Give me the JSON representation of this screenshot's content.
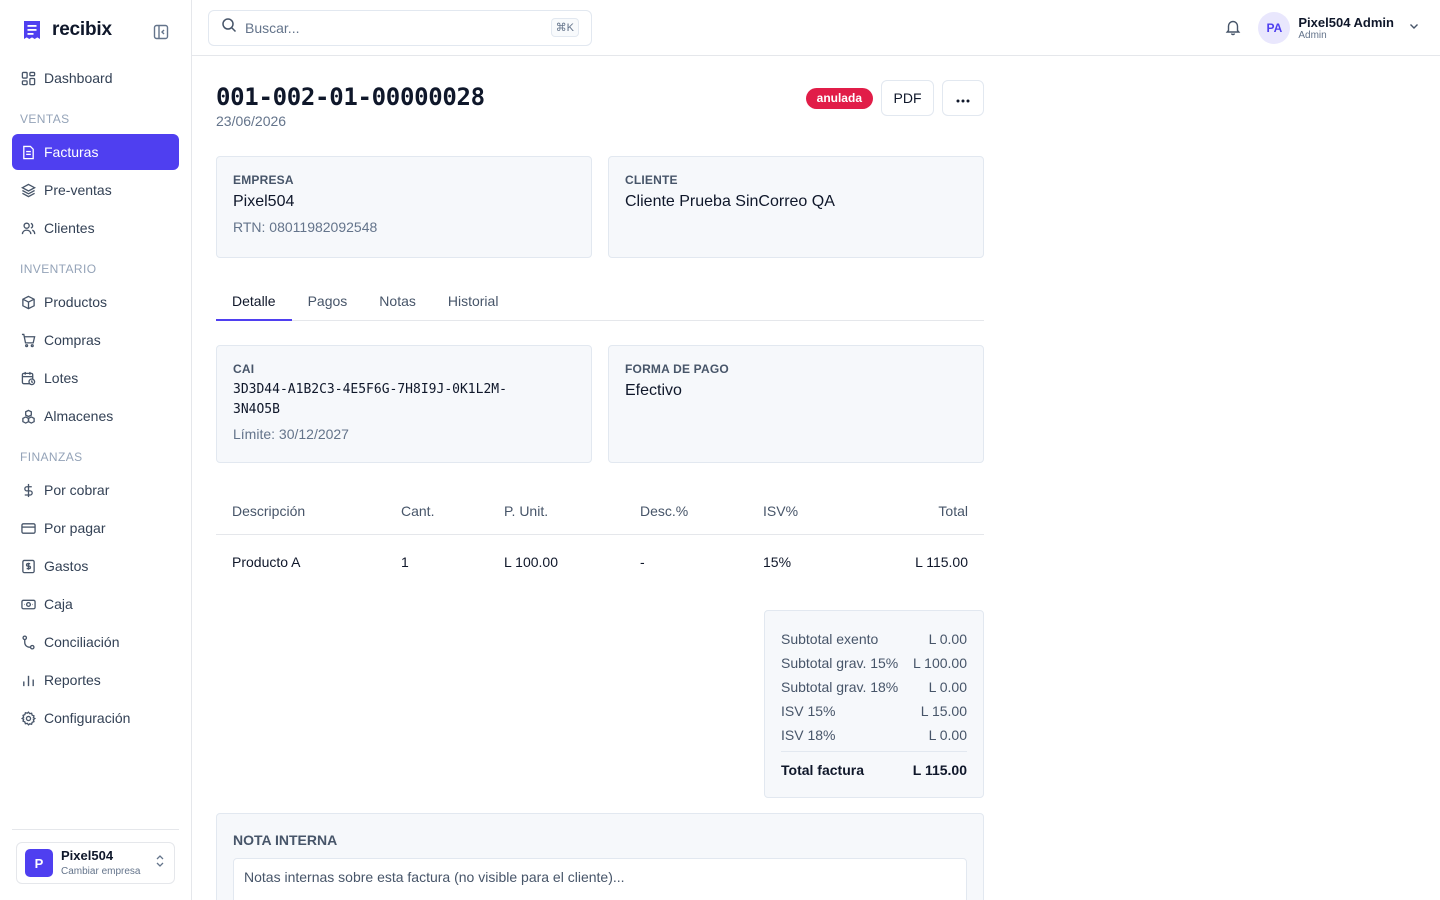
{
  "app": {
    "name": "recibix"
  },
  "sidebar": {
    "top_items": [
      {
        "label": "Dashboard",
        "icon": "dashboard-icon"
      }
    ],
    "sections": [
      {
        "title": "VENTAS",
        "items": [
          {
            "label": "Facturas",
            "icon": "invoice-icon",
            "active": true
          },
          {
            "label": "Pre-ventas",
            "icon": "layers-icon"
          },
          {
            "label": "Clientes",
            "icon": "users-icon"
          }
        ]
      },
      {
        "title": "INVENTARIO",
        "items": [
          {
            "label": "Productos",
            "icon": "box-icon"
          },
          {
            "label": "Compras",
            "icon": "cart-icon"
          },
          {
            "label": "Lotes",
            "icon": "calendar-icon"
          },
          {
            "label": "Almacenes",
            "icon": "warehouse-icon"
          }
        ]
      },
      {
        "title": "FINANZAS",
        "items": [
          {
            "label": "Por cobrar",
            "icon": "dollar-icon"
          },
          {
            "label": "Por pagar",
            "icon": "card-icon"
          },
          {
            "label": "Gastos",
            "icon": "receipt-icon"
          },
          {
            "label": "Caja",
            "icon": "cash-icon"
          },
          {
            "label": "Conciliación",
            "icon": "branch-icon"
          },
          {
            "label": "Reportes",
            "icon": "bar-chart-icon"
          },
          {
            "label": "Configuración",
            "icon": "gear-icon"
          }
        ]
      }
    ],
    "company": {
      "initial": "P",
      "name": "Pixel504",
      "sub": "Cambiar empresa"
    }
  },
  "topbar": {
    "search_placeholder": "Buscar...",
    "shortcut": "⌘K",
    "user": {
      "initials": "PA",
      "name": "Pixel504 Admin",
      "role": "Admin"
    }
  },
  "invoice": {
    "number": "001-002-01-00000028",
    "date": "23/06/2026",
    "status": "anulada",
    "pdf_label": "PDF",
    "more_label": "···",
    "empresa": {
      "label": "EMPRESA",
      "name": "Pixel504",
      "rtn": "RTN: 08011982092548"
    },
    "cliente": {
      "label": "CLIENTE",
      "name": "Cliente Prueba SinCorreo QA"
    },
    "tabs": [
      "Detalle",
      "Pagos",
      "Notas",
      "Historial"
    ],
    "cai": {
      "label": "CAI",
      "value": "3D3D44-A1B2C3-4E5F6G-7H8I9J-0K1L2M-3N4O5B",
      "limit": "Límite: 30/12/2027"
    },
    "payment": {
      "label": "FORMA DE PAGO",
      "value": "Efectivo"
    },
    "table": {
      "headers": [
        "Descripción",
        "Cant.",
        "P. Unit.",
        "Desc.%",
        "ISV%",
        "Total"
      ],
      "rows": [
        [
          "Producto A",
          "1",
          "L 100.00",
          "-",
          "15%",
          "L 115.00"
        ]
      ]
    },
    "totals": [
      {
        "label": "Subtotal exento",
        "value": "L 0.00"
      },
      {
        "label": "Subtotal grav. 15%",
        "value": "L 100.00"
      },
      {
        "label": "Subtotal grav. 18%",
        "value": "L 0.00"
      },
      {
        "label": "ISV 15%",
        "value": "L 15.00"
      },
      {
        "label": "ISV 18%",
        "value": "L 0.00"
      }
    ],
    "total_final": {
      "label": "Total factura",
      "value": "L 115.00"
    },
    "note": {
      "title": "NOTA INTERNA",
      "placeholder": "Notas internas sobre esta factura (no visible para el cliente)..."
    }
  },
  "colors": {
    "accent": "#4f3ff0",
    "danger": "#e11d48"
  }
}
